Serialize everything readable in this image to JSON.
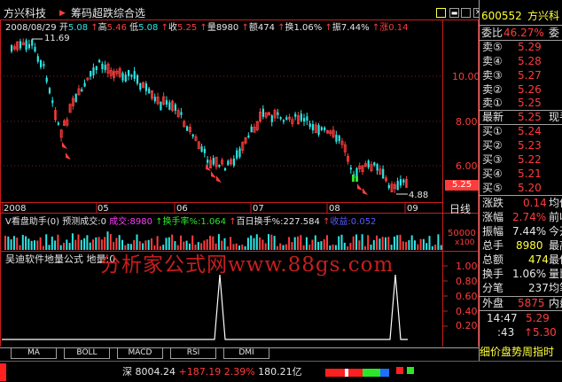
{
  "header": {
    "stock_name": "方兴科技",
    "indicator": "筹码超跌综合选",
    "icons": [
      "settings-icon",
      "minimize-icon",
      "restore-icon",
      "close-icon"
    ]
  },
  "info_bar": {
    "date": "2008/08/29",
    "open_label": "开",
    "open": "5.08",
    "high_label": "高",
    "high": "5.46",
    "low_label": "低",
    "low": "5.08",
    "close_label": "收",
    "close": "5.25",
    "volume_label": "量",
    "volume": "8980",
    "amount_label": "额",
    "amount": "474",
    "turnover_label": "换",
    "turnover": "1.06%",
    "amplitude_label": "振",
    "amplitude": "7.44%",
    "change_label": "涨",
    "change": "0.14"
  },
  "main_chart": {
    "max_label": "11.69",
    "min_label": "4.88",
    "current_price_tag": "5.25",
    "y_ticks": [
      "10.00",
      "8.00",
      "6.00"
    ],
    "x_ticks": [
      "2008",
      "05",
      "06",
      "07",
      "08",
      "09"
    ],
    "period_label": "日线"
  },
  "volume_panel": {
    "title": "V看盘助手(0)",
    "predicted_label": "预测成交:0",
    "volume_text": "成交:8980",
    "turnover_text": "换手率%:1.064",
    "hundred_day_text": "百日换手%:227.584",
    "profit_text": "收益:0.052",
    "y_tick": "50000",
    "y_unit": "x100"
  },
  "formula_panel": {
    "title": "吴迪软件地量公式",
    "value_label": "地量:0",
    "watermark": "分析家公式网www.88gs.com",
    "y_ticks": [
      "1.00",
      "0.80",
      "0.60",
      "0.40",
      "0.20"
    ]
  },
  "bottom_tabs": [
    "MA",
    "BOLL",
    "MACD",
    "RSI",
    "DMI"
  ],
  "status_bar": {
    "market": "深",
    "index_value": "8004.24",
    "index_change": "+187.19",
    "change_pct": "2.39%",
    "amount": "180.21亿"
  },
  "quote_panel": {
    "code": "600552",
    "name": "方兴科",
    "webi_label": "委比",
    "webi_value": "46.27%",
    "webi_extra": "委",
    "asks": [
      {
        "label": "卖⑤",
        "price": "5.29"
      },
      {
        "label": "卖④",
        "price": "5.28"
      },
      {
        "label": "卖③",
        "price": "5.27"
      },
      {
        "label": "卖②",
        "price": "5.26"
      },
      {
        "label": "卖①",
        "price": "5.25"
      }
    ],
    "last_label": "最新",
    "last_price": "5.25",
    "last_extra": "现手",
    "bids": [
      {
        "label": "买①",
        "price": "5.24"
      },
      {
        "label": "买②",
        "price": "5.23"
      },
      {
        "label": "买③",
        "price": "5.22"
      },
      {
        "label": "买④",
        "price": "5.21"
      },
      {
        "label": "买⑤",
        "price": "5.20"
      }
    ],
    "stats": [
      {
        "label": "涨跌",
        "value": "0.14",
        "extra": "均价"
      },
      {
        "label": "涨幅",
        "value": "2.74%",
        "extra": "前收"
      },
      {
        "label": "振幅",
        "value": "7.44%",
        "extra": "今开"
      },
      {
        "label": "总手",
        "value": "8980",
        "extra": "最高"
      },
      {
        "label": "总额",
        "value": "474",
        "extra": "最低"
      },
      {
        "label": "换手",
        "value": "1.06%",
        "extra": "量比"
      },
      {
        "label": "分笔",
        "value": "237",
        "extra": "均笔"
      }
    ],
    "outer_label": "外盘",
    "outer_value": "5875",
    "inner_label": "内盘",
    "ticks": [
      {
        "time": "14:47",
        "price": "5.29"
      },
      {
        "time": ":43",
        "price": "5.30"
      }
    ],
    "bottom_label": "细价盘势周指时"
  }
}
